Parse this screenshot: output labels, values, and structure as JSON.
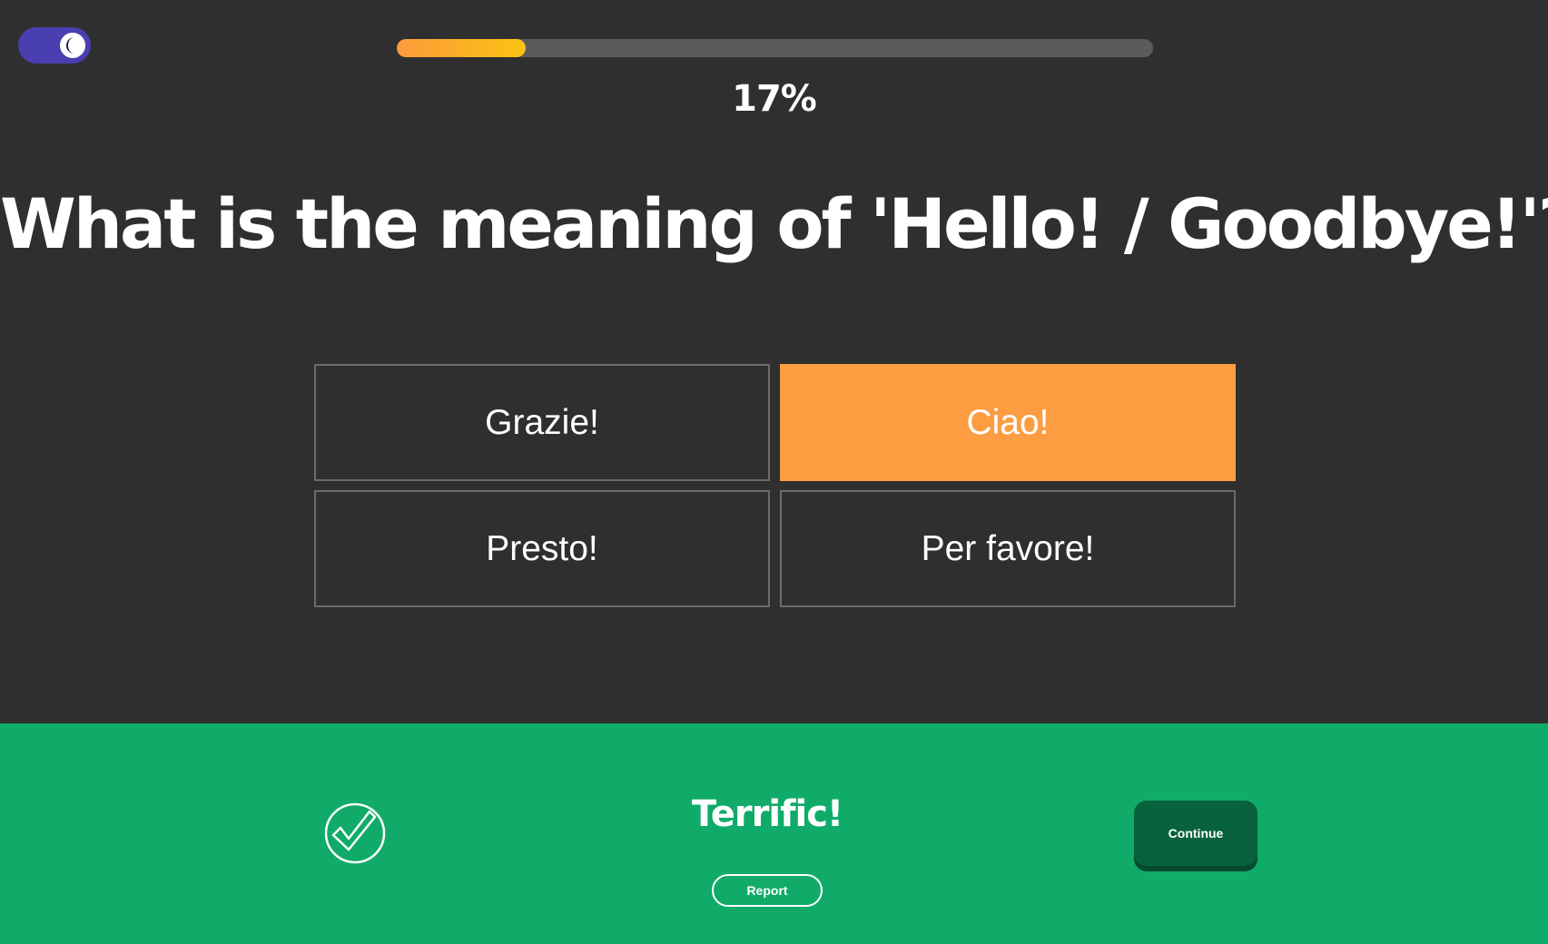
{
  "theme_toggle": {
    "icon": "moon-icon",
    "state": "dark"
  },
  "progress": {
    "value": 0.17,
    "label": "17%"
  },
  "question": {
    "text": "What is the meaning of 'Hello! / Goodbye!'?"
  },
  "answers": [
    {
      "label": "Grazie!",
      "selected": false
    },
    {
      "label": "Ciao!",
      "selected": true
    },
    {
      "label": "Presto!",
      "selected": false
    },
    {
      "label": "Per favore!",
      "selected": false
    }
  ],
  "feedback": {
    "icon": "check-circle-icon",
    "title": "Terrific!",
    "report_label": "Report",
    "continue_label": "Continue"
  },
  "colors": {
    "background": "#2f2f2f",
    "selected_answer": "#fc9d42",
    "feedback_bar": "#10ab69",
    "continue_button": "#08623d",
    "toggle": "#4a3fb0",
    "progress_start": "#fb9b3c",
    "progress_end": "#fbc312"
  }
}
